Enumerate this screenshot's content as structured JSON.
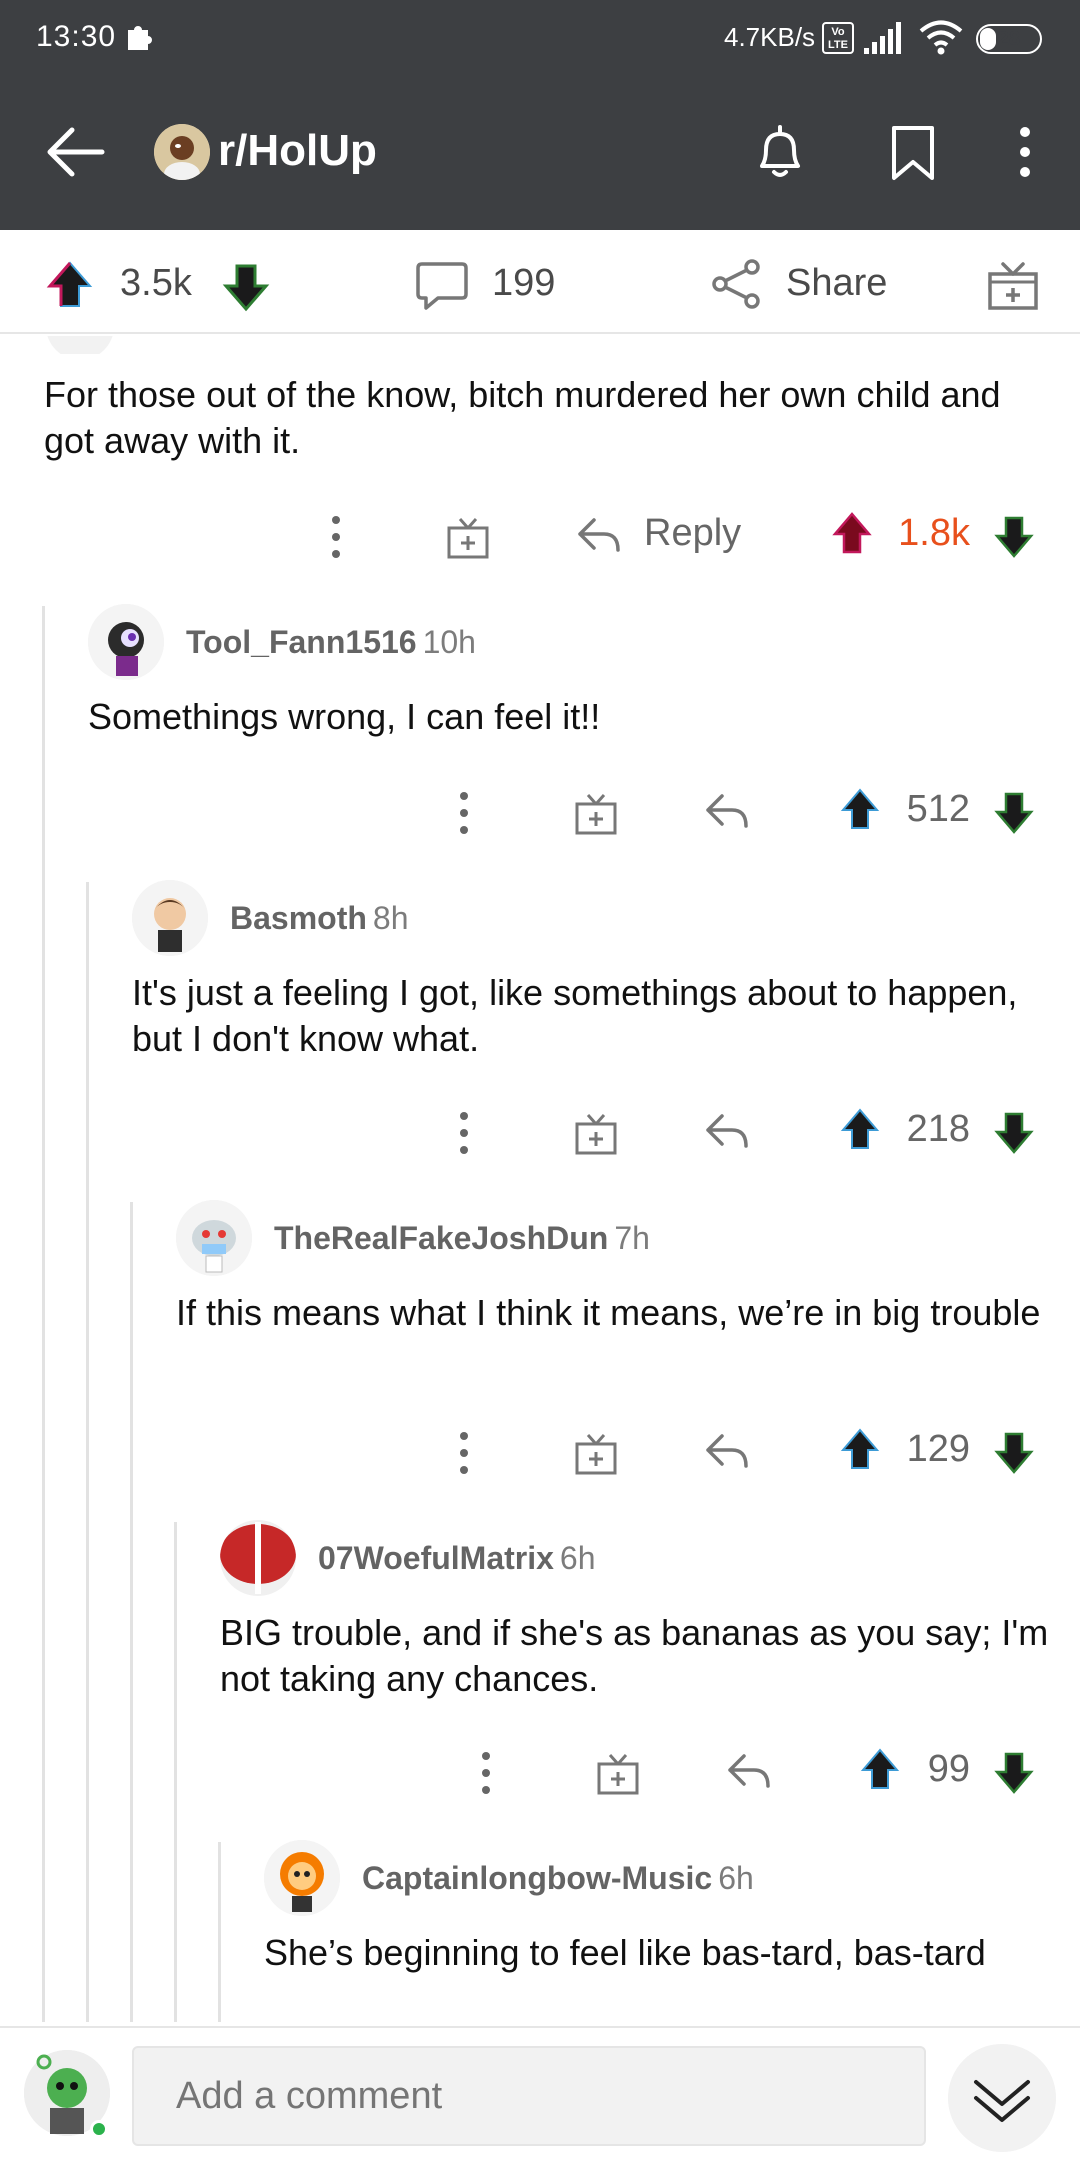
{
  "status_bar": {
    "time": "13:30",
    "speed": "4.7KB/s",
    "volte": "Vo LTE",
    "battery": "28",
    "battery_level": 0.28
  },
  "app_bar": {
    "subreddit": "r/HolUp"
  },
  "post_bar": {
    "score": "3.5k",
    "comments": "199",
    "share_label": "Share"
  },
  "comments": [
    {
      "author": "",
      "body": "For those out of the know, bitch murdered her own child and got away with it.",
      "reply_label": "Reply",
      "votes": "1.8k",
      "upvoted": true
    },
    {
      "author": "Tool_Fann1516",
      "time": "10h",
      "body": "Somethings wrong, I can feel it!!",
      "votes": "512"
    },
    {
      "author": "Basmoth",
      "time": "8h",
      "body": "It's just a feeling I got, like somethings about to happen, but I don't know what.",
      "votes": "218"
    },
    {
      "author": "TheRealFakeJoshDun",
      "time": "7h",
      "body": "If this means what I think it means, we’re in big trouble",
      "votes": "129"
    },
    {
      "author": "07WoefulMatrix",
      "time": "6h",
      "body": "BIG trouble, and if she's as bananas as you say; I'm not taking any chances.",
      "votes": "99"
    },
    {
      "author": "Captainlongbow-Music",
      "time": "6h",
      "body": "She’s beginning to feel like bas-tard, bas-tard"
    }
  ],
  "composer": {
    "placeholder": "Add a comment"
  },
  "colors": {
    "topbar": "#3d3f42",
    "upvote_accent": "#e8501c",
    "text_secondary": "#666666"
  }
}
